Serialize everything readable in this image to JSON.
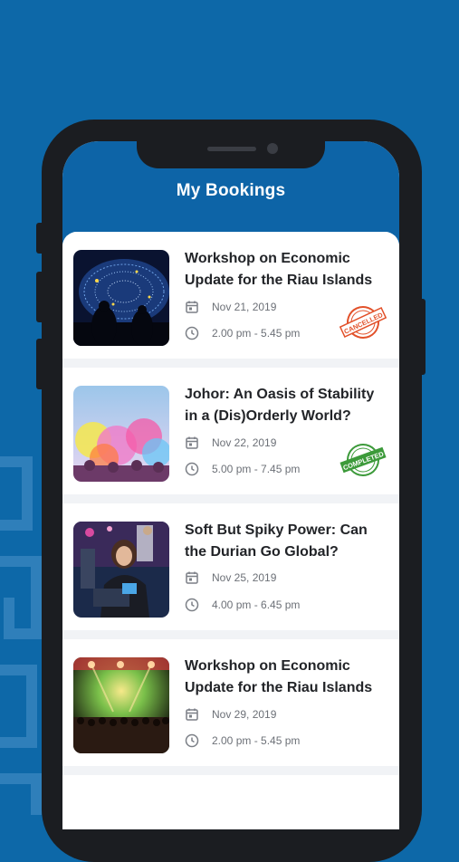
{
  "app": {
    "title": "My Bookings"
  },
  "bookings": [
    {
      "title": "Workshop on Economic Update for the Riau Islands",
      "date": "Nov 21, 2019",
      "time": "2.00 pm - 5.45 pm",
      "status": "CANCELLED",
      "status_color": "#e2512a",
      "image": "network-globe-photo"
    },
    {
      "title": "Johor: An Oasis of Stability in a (Dis)Orderly World?",
      "date": "Nov 22, 2019",
      "time": "5.00 pm - 7.45 pm",
      "status": "COMPLETED",
      "status_color": "#3c9a3a",
      "image": "color-powder-festival-photo"
    },
    {
      "title": "Soft But Spiky Power: Can the Durian Go Global?",
      "date": "Nov 25, 2019",
      "time": "4.00 pm - 6.45 pm",
      "status": "",
      "image": "woman-with-laptop-photo"
    },
    {
      "title": "Workshop on Economic Update for the Riau Islands",
      "date": "Nov 29, 2019",
      "time": "2.00 pm - 5.45 pm",
      "status": "",
      "image": "concert-stage-photo"
    }
  ],
  "icons": {
    "date": "calendar-icon",
    "time": "clock-icon"
  },
  "colors": {
    "header_bg": "#0d64a7",
    "page_bg": "#0d68a8",
    "phone_frame": "#1b1d21"
  }
}
